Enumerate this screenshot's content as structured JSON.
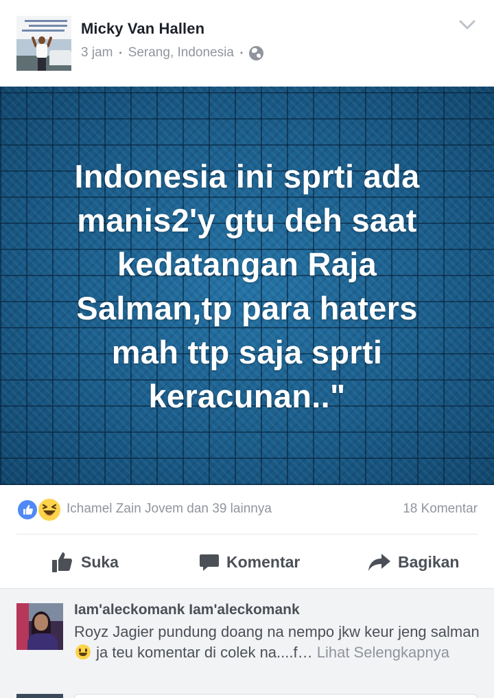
{
  "post": {
    "author": "Micky Van Hallen",
    "time": "3 jam",
    "location": "Serang, Indonesia",
    "separator": "•",
    "privacy_icon": "globe-icon",
    "menu_icon": "chevron-down-icon"
  },
  "image": {
    "caption": "Indonesia ini sprti ada manis2'y gtu deh saat kedatangan Raja Salman,tp para haters mah ttp saja sprti keracunan..\""
  },
  "reactions": {
    "icons": [
      "like-reaction-icon",
      "haha-reaction-icon"
    ],
    "names": "Ichamel Zain Jovem dan 39 lainnya",
    "comment_count": "18 Komentar"
  },
  "actions": {
    "like": "Suka",
    "comment": "Komentar",
    "share": "Bagikan"
  },
  "comment": {
    "name": "Iam'aleckomank Iam'aleckomank",
    "text_before_emoji": "Royz Jagier pundung doang na nempo jkw keur jeng salman",
    "text_after_emoji": " ja teu komentar di colek na....f… ",
    "see_more": "Lihat Selengkapnya",
    "emoji_icon": "grinning-emoji-icon"
  },
  "colors": {
    "like_blue": "#4f89f5",
    "haha_yellow": "#fcd34a",
    "image_blue": "#1b5f8c",
    "meta_grey": "#90949c"
  }
}
